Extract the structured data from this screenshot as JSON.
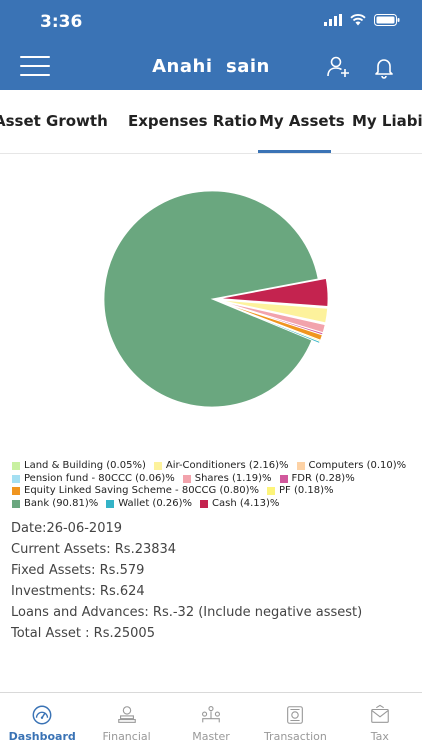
{
  "status_bar": {
    "time": "3:36",
    "icons": [
      "signal-icon",
      "wifi-icon",
      "battery-icon"
    ]
  },
  "header": {
    "title": "Anahi  sain",
    "menu_icon": "menu-icon",
    "add_user_icon": "add-user-icon",
    "bell_icon": "bell-icon"
  },
  "tabs": [
    {
      "label": "Asset Growth",
      "active": false
    },
    {
      "label": "Expenses Ratio",
      "active": false
    },
    {
      "label": "My Assets",
      "active": true
    },
    {
      "label": "My Liabilities",
      "active": false
    }
  ],
  "chart_data": {
    "type": "pie",
    "slices": [
      {
        "label": "Land & Building (0.05%)",
        "value": 0.05,
        "color": "#c8f0a0"
      },
      {
        "label": "Air-Conditioners (2.16)%",
        "value": 2.16,
        "color": "#fdf29c"
      },
      {
        "label": "Computers (0.10)%",
        "value": 0.1,
        "color": "#fdd2a5"
      },
      {
        "label": "Pension fund - 80CCC (0.06)%",
        "value": 0.06,
        "color": "#a4dff2"
      },
      {
        "label": "Shares (1.19)%",
        "value": 1.19,
        "color": "#f2a3ac"
      },
      {
        "label": "FDR (0.28)%",
        "value": 0.28,
        "color": "#d1589c"
      },
      {
        "label": "Equity Linked Saving Scheme - 80CCG (0.80)%",
        "value": 0.8,
        "color": "#f0951f"
      },
      {
        "label": "PF (0.18)%",
        "value": 0.18,
        "color": "#fdf47a"
      },
      {
        "label": "Bank (90.81)%",
        "value": 90.81,
        "color": "#6aa77f"
      },
      {
        "label": "Wallet (0.26)%",
        "value": 0.26,
        "color": "#34b3c7"
      },
      {
        "label": "Cash (4.13)%",
        "value": 4.13,
        "color": "#c4234f"
      }
    ],
    "legend_rows": [
      [
        0,
        1,
        2
      ],
      [
        3,
        4,
        5
      ],
      [
        6,
        7
      ],
      [
        8,
        9,
        10
      ]
    ]
  },
  "summary": {
    "date": "Date:26-06-2019",
    "current_assets": "Current Assets: Rs.23834",
    "fixed_assets": "Fixed Assets: Rs.579",
    "investments": "Investments: Rs.624",
    "loans": "Loans and Advances: Rs.-32 (Include negative assest)",
    "total": "Total Asset : Rs.25005"
  },
  "bottom_nav": [
    {
      "label": "Dashboard",
      "icon": "dashboard-icon",
      "active": true
    },
    {
      "label": "Financial",
      "icon": "financial-icon",
      "active": false
    },
    {
      "label": "Master",
      "icon": "master-icon",
      "active": false
    },
    {
      "label": "Transaction",
      "icon": "transaction-icon",
      "active": false
    },
    {
      "label": "Tax",
      "icon": "tax-icon",
      "active": false
    }
  ],
  "colors": {
    "primary": "#3a73b5",
    "inactive": "#999999"
  }
}
